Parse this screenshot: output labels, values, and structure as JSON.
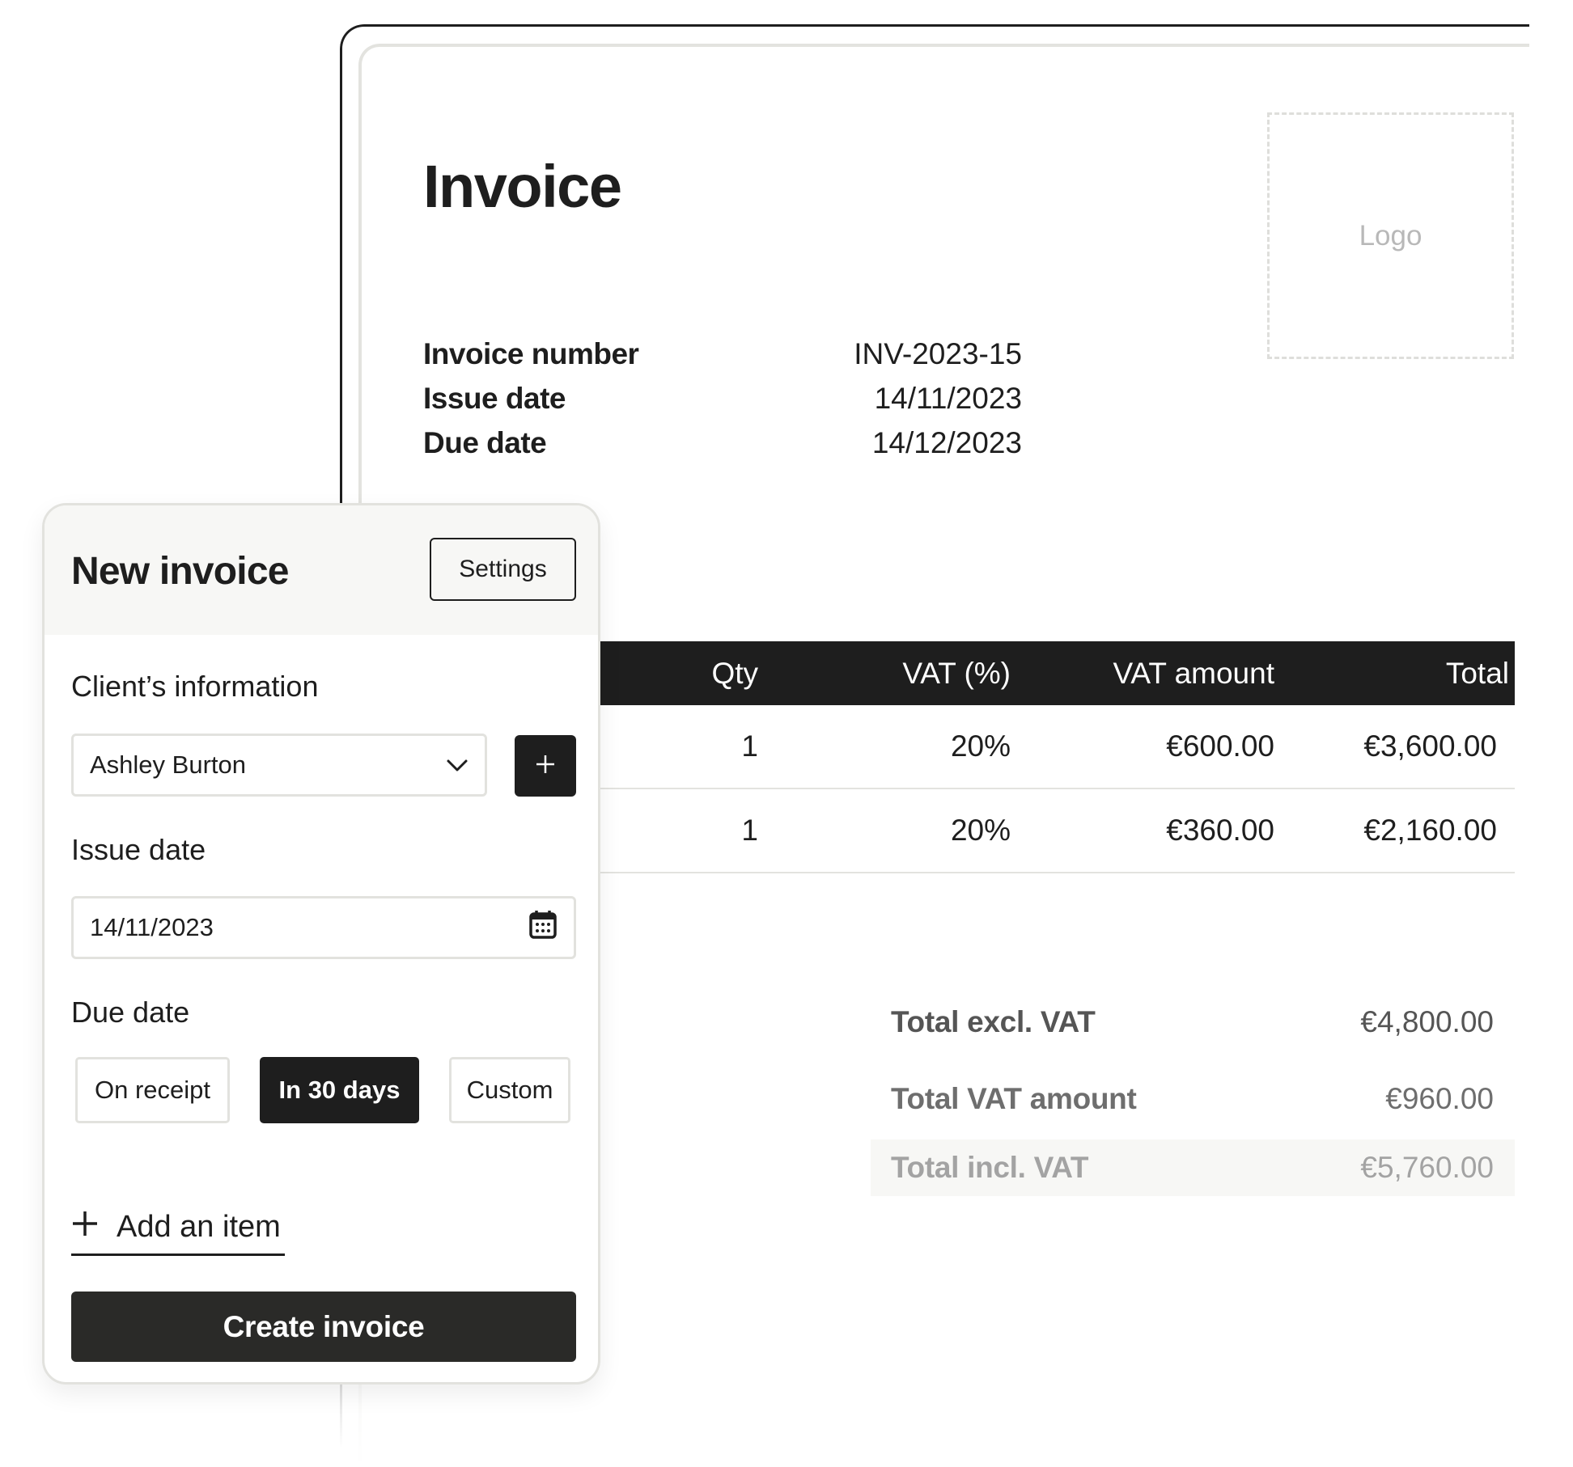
{
  "invoice": {
    "title": "Invoice",
    "logo_placeholder": "Logo",
    "meta": [
      {
        "label": "Invoice number",
        "value": "INV-2023-15"
      },
      {
        "label": "Issue date",
        "value": "14/11/2023"
      },
      {
        "label": "Due date",
        "value": "14/12/2023"
      }
    ],
    "table": {
      "headers": {
        "qty": "Qty",
        "vat_pct": "VAT (%)",
        "vat_amount": "VAT amount",
        "total": "Total"
      },
      "rows": [
        {
          "qty": "1",
          "vat_pct": "20%",
          "vat_amount": "€600.00",
          "total": "€3,600.00"
        },
        {
          "qty": "1",
          "vat_pct": "20%",
          "vat_amount": "€360.00",
          "total": "€2,160.00"
        }
      ]
    },
    "totals": [
      {
        "label": "Total excl. VAT",
        "value": "€4,800.00"
      },
      {
        "label": "Total VAT amount",
        "value": "€960.00"
      },
      {
        "label": "Total incl. VAT",
        "value": "€5,760.00"
      }
    ]
  },
  "panel": {
    "title": "New invoice",
    "settings_label": "Settings",
    "client_section_label": "Client’s information",
    "client_selected": "Ashley Burton",
    "issue_date_label": "Issue date",
    "issue_date_value": "14/11/2023",
    "due_date_label": "Due date",
    "due_options": [
      {
        "label": "On receipt",
        "active": false
      },
      {
        "label": "In 30 days",
        "active": true
      },
      {
        "label": "Custom",
        "active": false
      }
    ],
    "add_item_label": "Add an item",
    "create_label": "Create invoice"
  },
  "icons": {
    "chevron": "chevron-down-icon",
    "plus": "plus-icon",
    "calendar": "calendar-icon"
  },
  "colors": {
    "ink": "#1e1e1e",
    "panel_header_bg": "#f7f7f5",
    "border": "#e2e2de"
  }
}
